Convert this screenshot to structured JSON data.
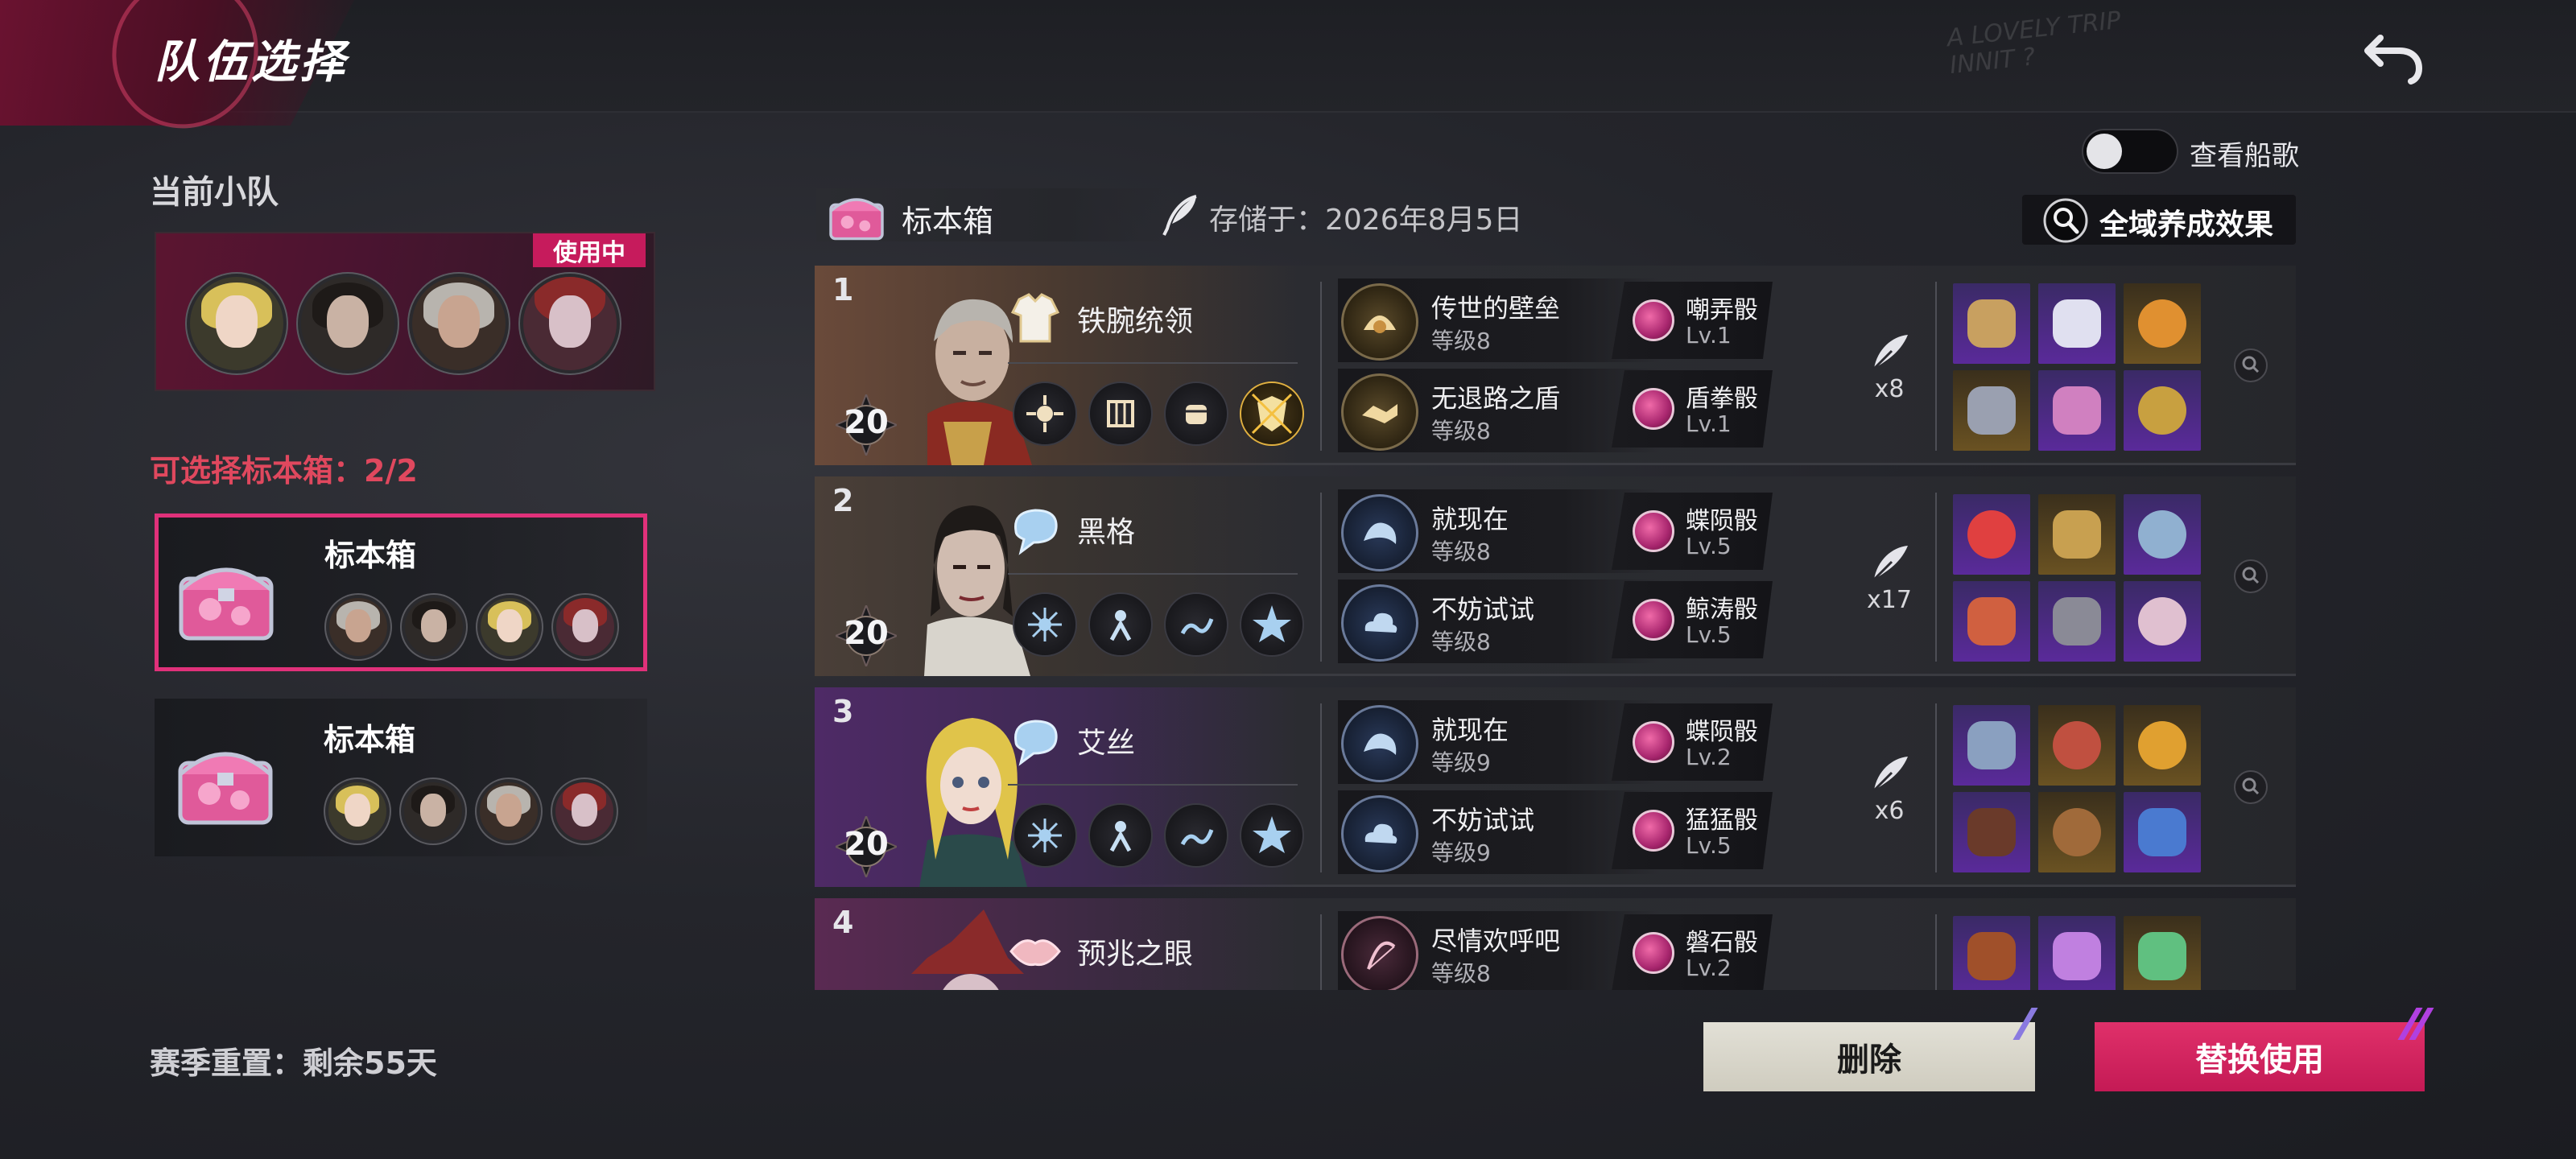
{
  "header": {
    "title": "队伍选择",
    "watermark_line1": "A LOVELY TRIP",
    "watermark_line2": "INNIT ?",
    "back_icon": "back-arrow-icon"
  },
  "current_squad": {
    "label": "当前小队",
    "badge": "使用中",
    "members": [
      "blonde-girl",
      "dark-haired-man",
      "grey-haired-man",
      "witch-hat-woman"
    ]
  },
  "selectable": {
    "label": "可选择标本箱：2/2",
    "boxes": [
      {
        "title": "标本箱",
        "selected": true,
        "members": [
          "grey-haired-man",
          "dark-haired-man",
          "blonde-girl",
          "witch-hat-woman"
        ]
      },
      {
        "title": "标本箱",
        "selected": false,
        "members": [
          "blonde-girl",
          "dark-haired-man",
          "grey-haired-man",
          "witch-hat-woman"
        ]
      }
    ]
  },
  "season_reset": "赛季重置：剩余55天",
  "right_header": {
    "toggle_label": "查看船歌",
    "toggle_on": false,
    "box_label": "标本箱",
    "stored": "存储于：2026年8月5日",
    "global_effect": "全域养成效果"
  },
  "characters": [
    {
      "index": "1",
      "level": "20",
      "name": "铁腕统领",
      "theme": "#6a4a3a",
      "traits": [
        {
          "name": "传世的壁垒",
          "level": "等级8"
        },
        {
          "name": "无退路之盾",
          "level": "等级8"
        }
      ],
      "dice": [
        {
          "name": "嘲弄骰",
          "level": "Lv.1"
        },
        {
          "name": "盾拳骰",
          "level": "Lv.1"
        }
      ],
      "feather_count": "x8",
      "equipment": [
        "purple",
        "purple",
        "gold",
        "gold",
        "purple",
        "purple"
      ]
    },
    {
      "index": "2",
      "level": "20",
      "name": "黑格",
      "theme": "#4a3f38",
      "traits": [
        {
          "name": "就现在",
          "level": "等级8"
        },
        {
          "name": "不妨试试",
          "level": "等级8"
        }
      ],
      "dice": [
        {
          "name": "蝶陨骰",
          "level": "Lv.5"
        },
        {
          "name": "鲸涛骰",
          "level": "Lv.5"
        }
      ],
      "feather_count": "x17",
      "equipment": [
        "purple",
        "gold",
        "purple",
        "purple",
        "purple",
        "purple"
      ]
    },
    {
      "index": "3",
      "level": "20",
      "name": "艾丝",
      "theme": "#4e2a66",
      "traits": [
        {
          "name": "就现在",
          "level": "等级9"
        },
        {
          "name": "不妨试试",
          "level": "等级9"
        }
      ],
      "dice": [
        {
          "name": "蝶陨骰",
          "level": "Lv.2"
        },
        {
          "name": "猛猛骰",
          "level": "Lv.5"
        }
      ],
      "feather_count": "x6",
      "equipment": [
        "purple",
        "gold",
        "gold",
        "purple",
        "gold",
        "purple"
      ]
    },
    {
      "index": "4",
      "level": "",
      "name": "预兆之眼",
      "theme": "#5a2a52",
      "traits": [
        {
          "name": "尽情欢呼吧",
          "level": "等级8"
        }
      ],
      "dice": [
        {
          "name": "磐石骰",
          "level": "Lv.2"
        }
      ],
      "feather_count": "",
      "equipment": [
        "purple",
        "purple",
        "gold"
      ]
    }
  ],
  "buttons": {
    "delete": "删除",
    "replace": "替换使用"
  },
  "colors": {
    "accent_pink": "#c61b5c",
    "warning_red": "#e0485e",
    "delete_bg": "#d8d6cb"
  }
}
